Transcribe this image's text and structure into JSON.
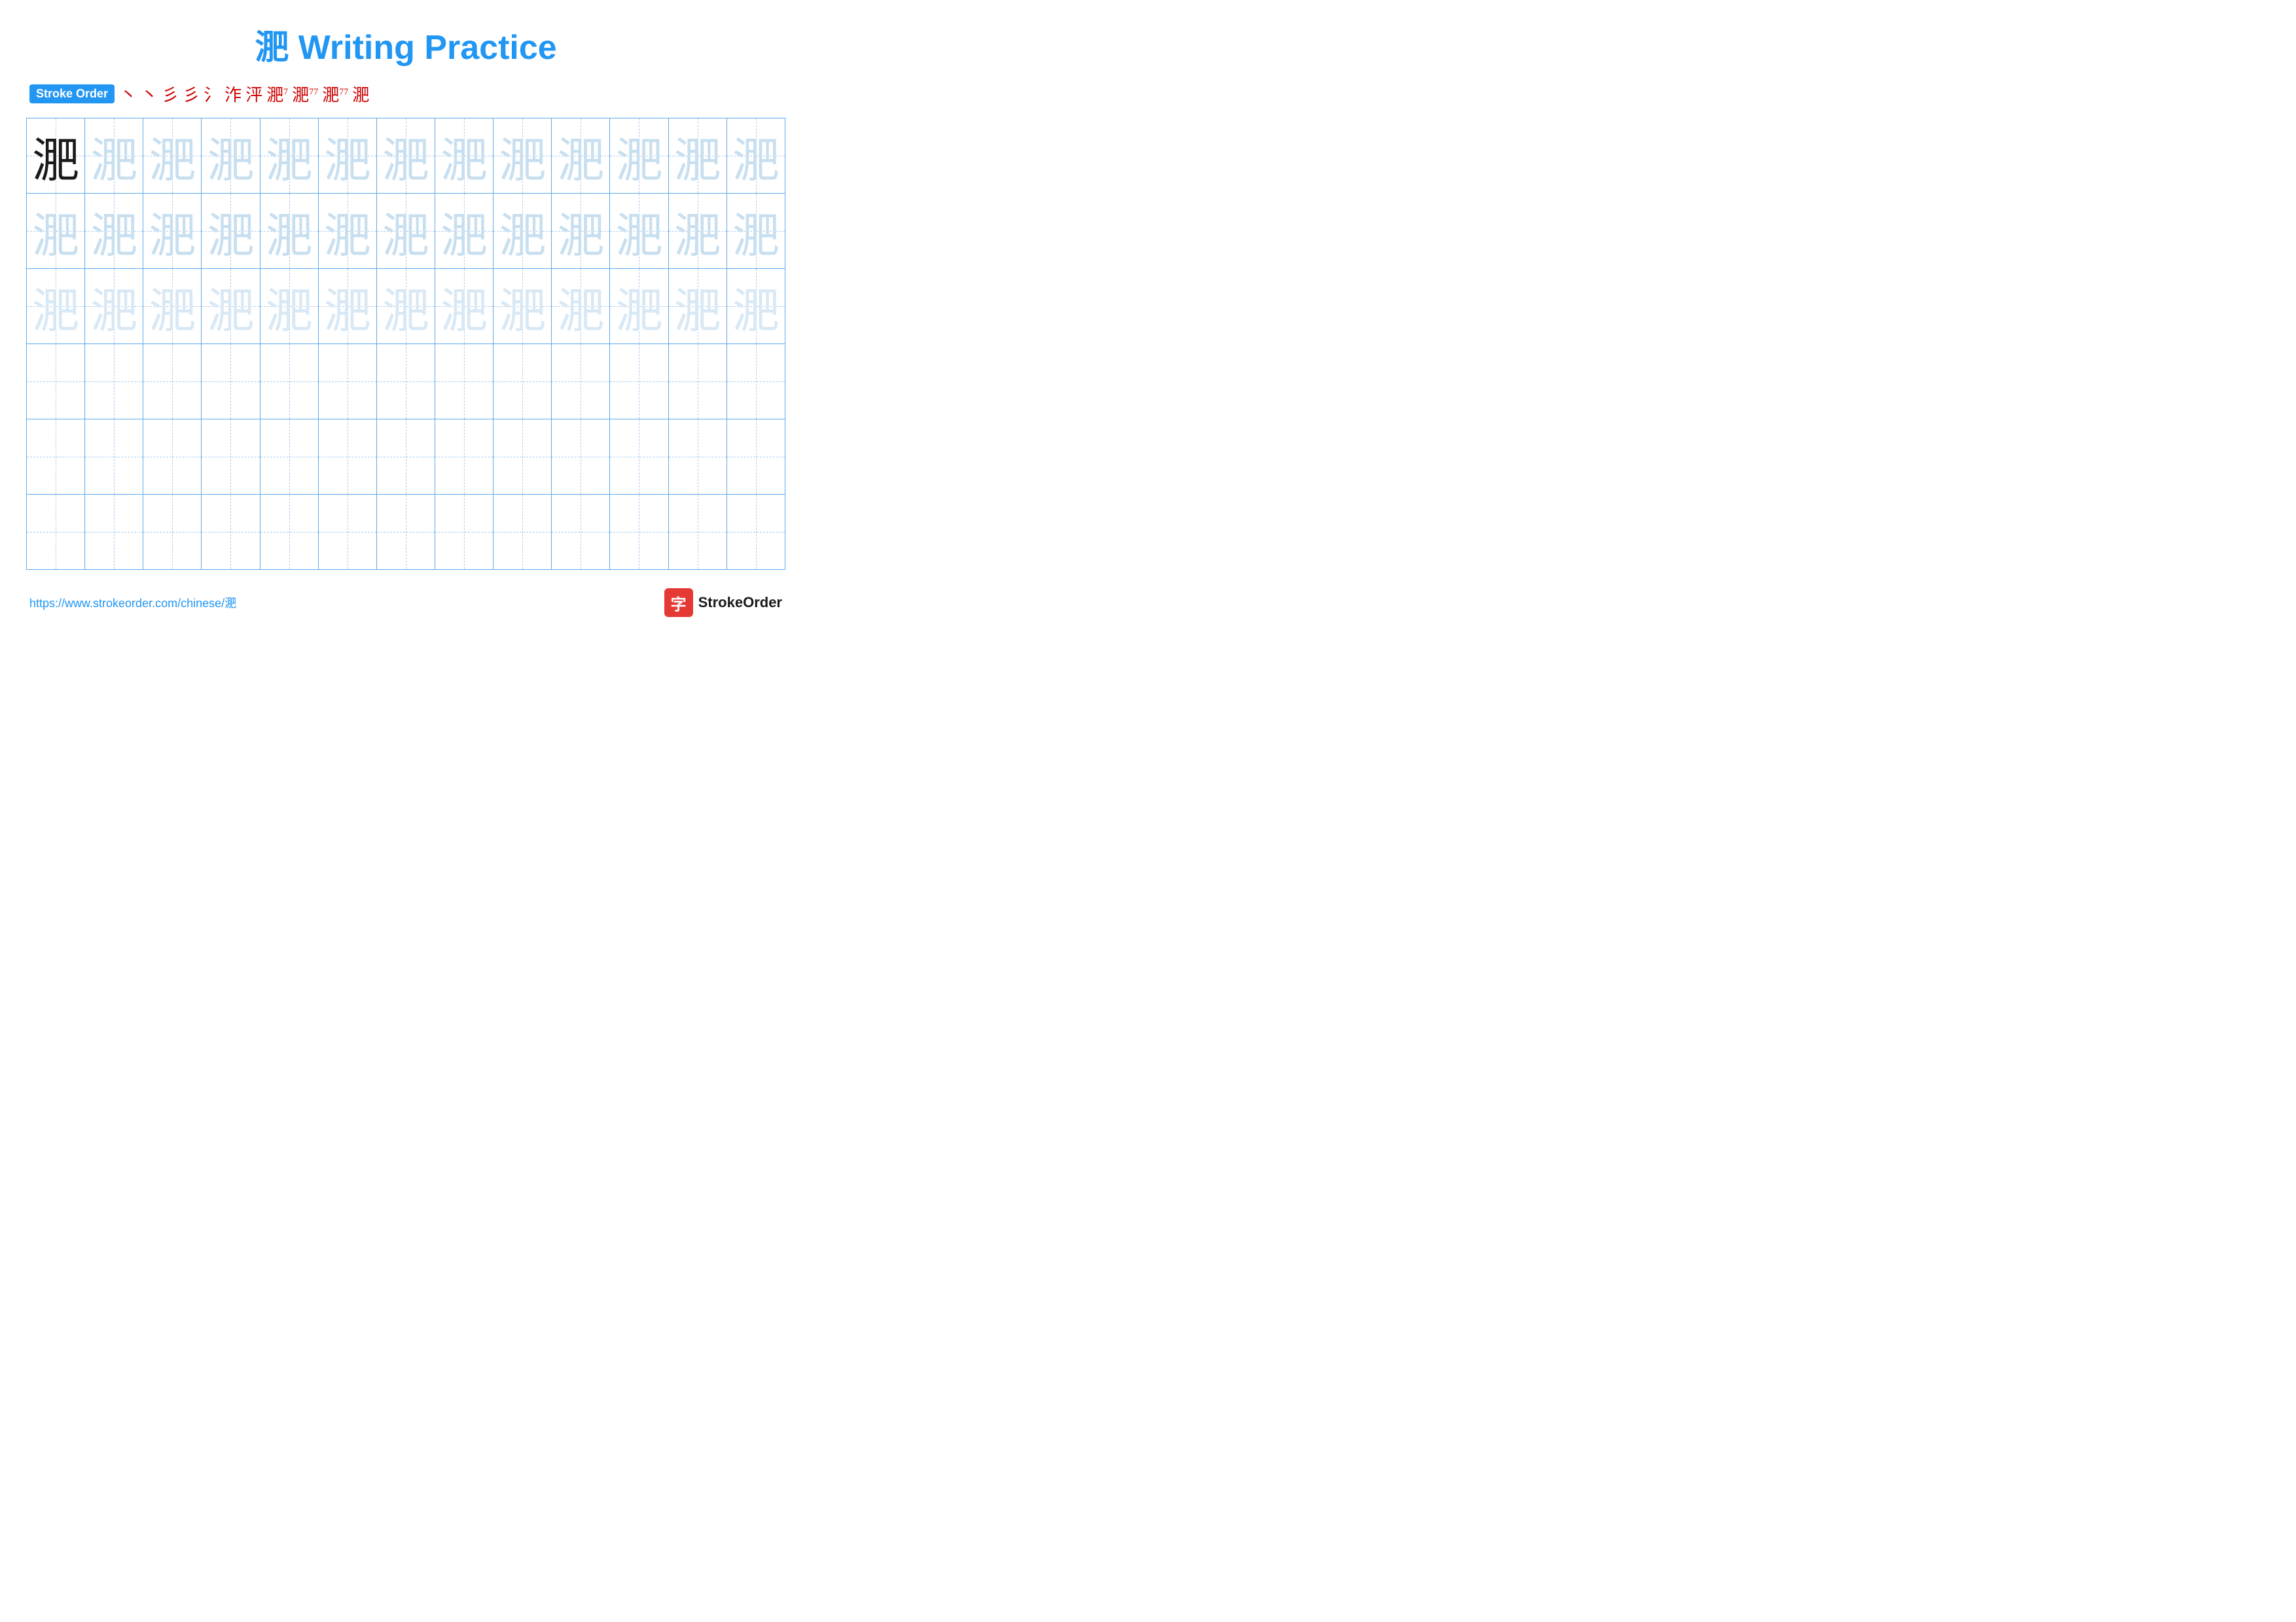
{
  "title": "淝 Writing Practice",
  "stroke_order": {
    "badge": "Stroke Order",
    "steps": [
      "丶",
      "丶",
      "𝆺𝅥",
      "𝆹",
      "氵",
      "泎",
      "泙",
      "淝˥",
      "淝˥˥",
      "淝˥˥˥",
      "淝"
    ]
  },
  "char": "淝",
  "row1_type": "dark_then_light1",
  "row2_type": "light1",
  "row3_type": "light2",
  "row4_type": "empty",
  "row5_type": "empty",
  "row6_type": "empty",
  "cols": 13,
  "footer": {
    "url": "https://www.strokeorder.com/chinese/淝",
    "logo_char": "字",
    "logo_text": "StrokeOrder"
  }
}
